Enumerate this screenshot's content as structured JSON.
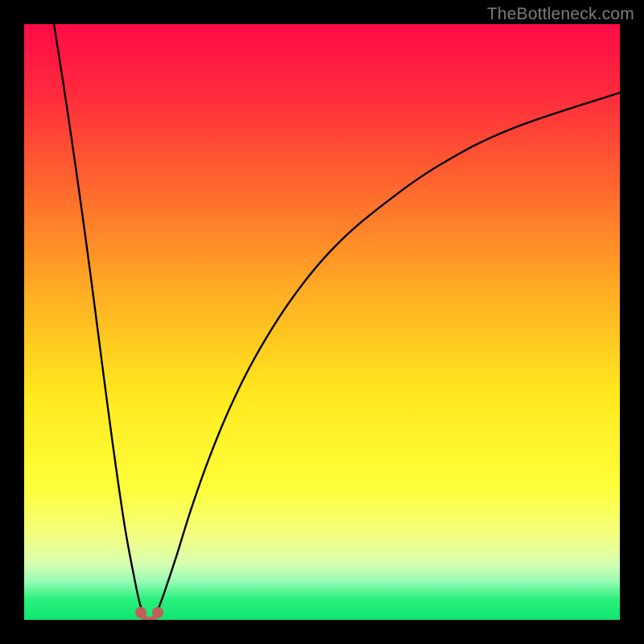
{
  "watermark": {
    "text": "TheBottleneck.com"
  },
  "chart_data": {
    "type": "line",
    "title": "",
    "xlabel": "",
    "ylabel": "",
    "xlim": [
      0,
      100
    ],
    "ylim": [
      0,
      100
    ],
    "grid": false,
    "legend": false,
    "gradient_stops": [
      {
        "offset": 0.0,
        "color": "#ff0b47"
      },
      {
        "offset": 0.12,
        "color": "#ff2b3c"
      },
      {
        "offset": 0.28,
        "color": "#ff6a2d"
      },
      {
        "offset": 0.45,
        "color": "#ffad23"
      },
      {
        "offset": 0.62,
        "color": "#ffe81e"
      },
      {
        "offset": 0.78,
        "color": "#fdff3a"
      },
      {
        "offset": 0.86,
        "color": "#f2ff82"
      },
      {
        "offset": 0.905,
        "color": "#d7ffb0"
      },
      {
        "offset": 0.935,
        "color": "#98fcb6"
      },
      {
        "offset": 0.965,
        "color": "#2bf07d"
      },
      {
        "offset": 1.0,
        "color": "#0fe66f"
      }
    ],
    "series": [
      {
        "name": "left-branch",
        "type": "line",
        "x": [
          5.0,
          6.5,
          8.0,
          9.5,
          11.0,
          12.5,
          14.0,
          15.5,
          17.0,
          18.5,
          19.3,
          19.8,
          20.0
        ],
        "y": [
          100,
          90.5,
          80.5,
          70.0,
          59.0,
          47.5,
          36.0,
          25.0,
          15.0,
          7.0,
          3.2,
          1.5,
          0.8
        ]
      },
      {
        "name": "right-branch",
        "type": "line",
        "x": [
          22.0,
          22.5,
          23.5,
          25.5,
          28.0,
          31.0,
          34.5,
          39.0,
          45.0,
          52.0,
          60.0,
          70.0,
          82.0,
          100.0
        ],
        "y": [
          0.8,
          1.8,
          4.5,
          10.5,
          18.5,
          27.0,
          35.5,
          44.5,
          54.0,
          62.5,
          69.5,
          76.5,
          82.5,
          88.5
        ]
      }
    ],
    "markers": [
      {
        "name": "left-min-marker",
        "x": 19.6,
        "y": 1.2
      },
      {
        "name": "right-min-marker",
        "x": 22.4,
        "y": 1.2
      }
    ],
    "marker_connector": {
      "x": [
        19.6,
        20.2,
        21.0,
        21.8,
        22.4
      ],
      "y": [
        1.2,
        0.3,
        0.0,
        0.3,
        1.2
      ]
    }
  }
}
